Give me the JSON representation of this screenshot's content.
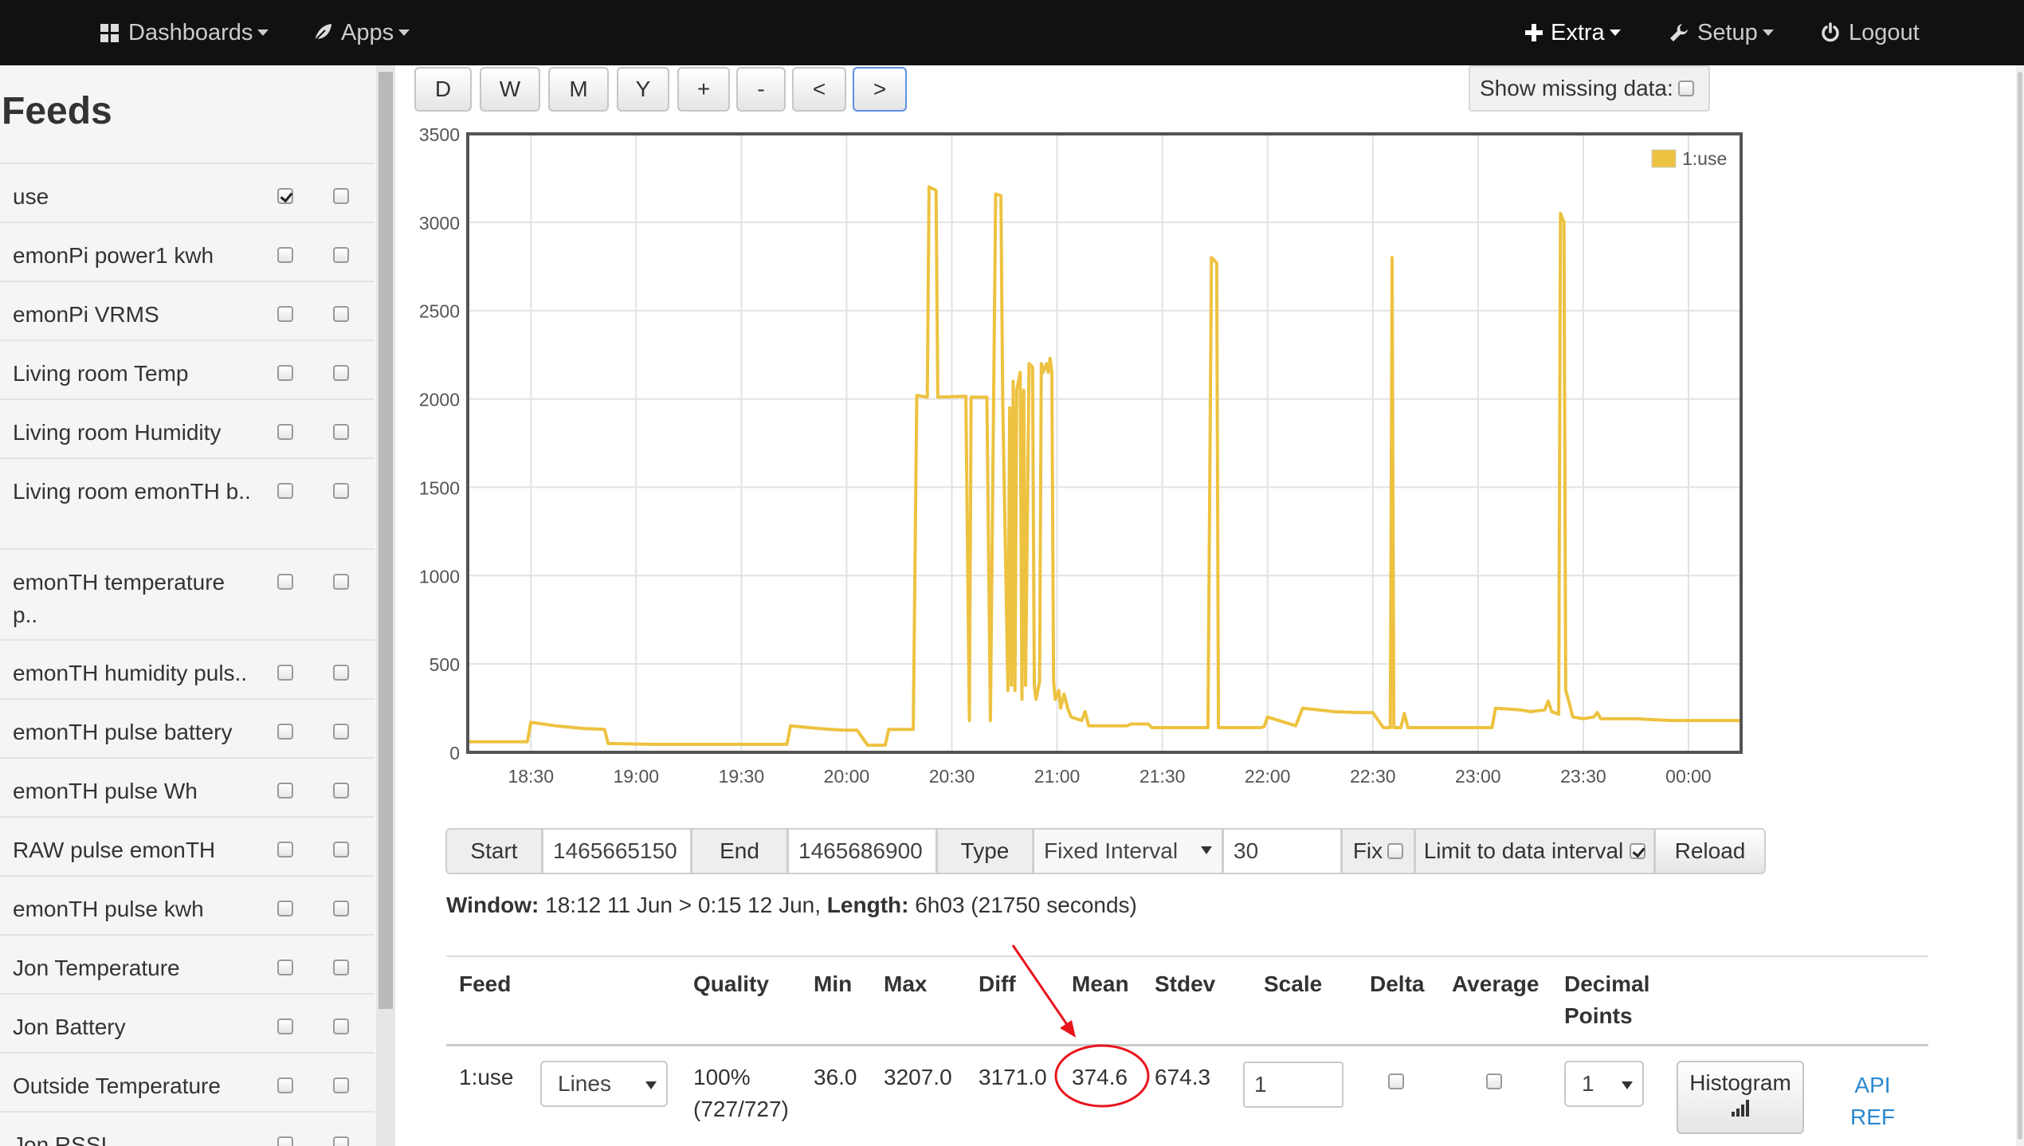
{
  "nav": {
    "dashboards": "Dashboards",
    "apps": "Apps",
    "extra": "Extra",
    "setup": "Setup",
    "logout": "Logout"
  },
  "sidebar": {
    "title": "Feeds",
    "feeds": [
      {
        "name": "use",
        "left_checked": true,
        "right_checked": false
      },
      {
        "name": "emonPi power1 kwh",
        "left_checked": false,
        "right_checked": false
      },
      {
        "name": "emonPi VRMS",
        "left_checked": false,
        "right_checked": false
      },
      {
        "name": "Living room Temp",
        "left_checked": false,
        "right_checked": false
      },
      {
        "name": "Living room Humidity",
        "left_checked": false,
        "right_checked": false
      },
      {
        "name": "Living room emonTH b..",
        "left_checked": false,
        "right_checked": false
      },
      {
        "name": "emonTH temperature p..",
        "left_checked": false,
        "right_checked": false
      },
      {
        "name": "emonTH humidity puls..",
        "left_checked": false,
        "right_checked": false
      },
      {
        "name": "emonTH pulse battery",
        "left_checked": false,
        "right_checked": false
      },
      {
        "name": "emonTH pulse Wh",
        "left_checked": false,
        "right_checked": false
      },
      {
        "name": "RAW pulse emonTH",
        "left_checked": false,
        "right_checked": false
      },
      {
        "name": "emonTH pulse kwh",
        "left_checked": false,
        "right_checked": false
      },
      {
        "name": "Jon Temperature",
        "left_checked": false,
        "right_checked": false
      },
      {
        "name": "Jon Battery",
        "left_checked": false,
        "right_checked": false
      },
      {
        "name": "Outside Temperature",
        "left_checked": false,
        "right_checked": false
      },
      {
        "name": "Jon RSSI",
        "left_checked": false,
        "right_checked": false
      }
    ]
  },
  "toolbar": {
    "buttons": [
      "D",
      "W",
      "M",
      "Y",
      "+",
      "-",
      "<",
      ">"
    ],
    "selected": ">",
    "show_missing_label": "Show missing data:"
  },
  "chart_data": {
    "type": "line",
    "y_ticks": [
      "0",
      "500",
      "1000",
      "1500",
      "2000",
      "2500",
      "3000",
      "3500"
    ],
    "ylim": [
      0,
      3500
    ],
    "x_ticks": [
      "18:30",
      "19:00",
      "19:30",
      "20:00",
      "20:30",
      "21:00",
      "21:30",
      "22:00",
      "22:30",
      "23:00",
      "23:30",
      "00:00"
    ],
    "x_tick_minutes": [
      1110,
      1140,
      1170,
      1200,
      1230,
      1260,
      1290,
      1320,
      1350,
      1380,
      1410,
      1440
    ],
    "xlim_minutes": [
      1092,
      1455
    ],
    "grid": true,
    "legend_position": "top-right",
    "color": "#edc240",
    "series": [
      {
        "name": "1:use",
        "points": [
          [
            1092,
            60
          ],
          [
            1109,
            60
          ],
          [
            1110,
            170
          ],
          [
            1117,
            150
          ],
          [
            1125,
            135
          ],
          [
            1131,
            130
          ],
          [
            1132,
            50
          ],
          [
            1145,
            45
          ],
          [
            1160,
            45
          ],
          [
            1170,
            45
          ],
          [
            1180,
            45
          ],
          [
            1183,
            45
          ],
          [
            1184,
            150
          ],
          [
            1192,
            135
          ],
          [
            1199,
            125
          ],
          [
            1203,
            125
          ],
          [
            1206,
            40
          ],
          [
            1211,
            40
          ],
          [
            1212,
            130
          ],
          [
            1219,
            130
          ],
          [
            1220,
            2020
          ],
          [
            1223,
            2010
          ],
          [
            1223.5,
            3200
          ],
          [
            1225.5,
            3180
          ],
          [
            1226,
            2010
          ],
          [
            1234,
            2015
          ],
          [
            1235,
            180
          ],
          [
            1235.5,
            2010
          ],
          [
            1240,
            2010
          ],
          [
            1241,
            180
          ],
          [
            1242.5,
            3160
          ],
          [
            1244,
            3150
          ],
          [
            1244.5,
            2010
          ],
          [
            1246,
            350
          ],
          [
            1246.5,
            1950
          ],
          [
            1247,
            380
          ],
          [
            1247.5,
            2100
          ],
          [
            1248,
            350
          ],
          [
            1248.5,
            2050
          ],
          [
            1249.5,
            2150
          ],
          [
            1250,
            300
          ],
          [
            1250.5,
            2050
          ],
          [
            1251,
            380
          ],
          [
            1252,
            2200
          ],
          [
            1253,
            2180
          ],
          [
            1253.5,
            380
          ],
          [
            1254,
            300
          ],
          [
            1255,
            400
          ],
          [
            1255.5,
            2200
          ],
          [
            1256,
            2150
          ],
          [
            1257,
            2200
          ],
          [
            1257.5,
            2150
          ],
          [
            1258,
            2230
          ],
          [
            1258.5,
            2150
          ],
          [
            1259,
            400
          ],
          [
            1259.5,
            300
          ],
          [
            1260.5,
            350
          ],
          [
            1261,
            250
          ],
          [
            1262,
            330
          ],
          [
            1263,
            250
          ],
          [
            1264,
            200
          ],
          [
            1267,
            180
          ],
          [
            1268,
            230
          ],
          [
            1269,
            150
          ],
          [
            1275,
            150
          ],
          [
            1280,
            150
          ],
          [
            1281,
            160
          ],
          [
            1286,
            160
          ],
          [
            1287,
            140
          ],
          [
            1299,
            140
          ],
          [
            1303,
            140
          ],
          [
            1304,
            2800
          ],
          [
            1305.5,
            2770
          ],
          [
            1306,
            140
          ],
          [
            1318,
            140
          ],
          [
            1319,
            145
          ],
          [
            1320,
            200
          ],
          [
            1328,
            150
          ],
          [
            1330,
            250
          ],
          [
            1339,
            230
          ],
          [
            1346,
            225
          ],
          [
            1350,
            225
          ],
          [
            1353,
            140
          ],
          [
            1355,
            140
          ],
          [
            1355.5,
            2800
          ],
          [
            1356,
            140
          ],
          [
            1358,
            140
          ],
          [
            1359,
            220
          ],
          [
            1360,
            140
          ],
          [
            1372,
            140
          ],
          [
            1383,
            140
          ],
          [
            1384,
            140
          ],
          [
            1385,
            250
          ],
          [
            1392,
            240
          ],
          [
            1395,
            230
          ],
          [
            1399,
            240
          ],
          [
            1400,
            290
          ],
          [
            1401,
            230
          ],
          [
            1403,
            215
          ],
          [
            1403.5,
            3050
          ],
          [
            1404.5,
            3000
          ],
          [
            1405,
            350
          ],
          [
            1406,
            280
          ],
          [
            1407,
            200
          ],
          [
            1410,
            190
          ],
          [
            1413,
            200
          ],
          [
            1414,
            225
          ],
          [
            1415,
            190
          ],
          [
            1425,
            190
          ],
          [
            1435,
            180
          ],
          [
            1455,
            180
          ]
        ]
      }
    ]
  },
  "controls": {
    "start_label": "Start",
    "start_value": "1465665150",
    "end_label": "End",
    "end_value": "1465686900",
    "type_label": "Type",
    "type_value": "Fixed Interval",
    "interval_value": "30",
    "fix_label": "Fix",
    "limit_label": "Limit to data interval",
    "limit_checked": true,
    "reload_label": "Reload"
  },
  "window_info": {
    "window_label": "Window:",
    "window_value": " 18:12 11 Jun > 0:15 12 Jun,",
    "length_label": " Length:",
    "length_value": " 6h03 (21750 seconds)"
  },
  "stats": {
    "headers": {
      "feed": "Feed",
      "quality": "Quality",
      "min": "Min",
      "max": "Max",
      "diff": "Diff",
      "mean": "Mean",
      "stdev": "Stdev",
      "scale": "Scale",
      "delta": "Delta",
      "average": "Average",
      "decimal_1": "Decimal",
      "decimal_2": "Points"
    },
    "row": {
      "feed": "1:use",
      "plot_type": "Lines",
      "quality": "100%",
      "quality_detail": "(727/727)",
      "min": "36.0",
      "max": "3207.0",
      "diff": "3171.0",
      "mean": "374.6",
      "stdev": "674.3",
      "scale": "1",
      "decimal_points": "1",
      "histogram_label": "Histogram",
      "api_1": "API",
      "api_2": "REF"
    }
  },
  "annotation_color": "#e8141c"
}
